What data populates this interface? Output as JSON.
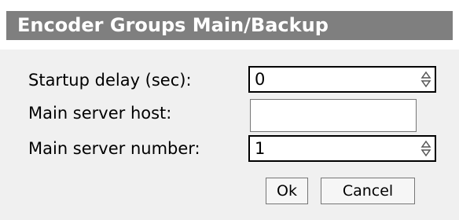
{
  "dialog": {
    "title": "Encoder Groups Main/Backup"
  },
  "form": {
    "startup_delay": {
      "label": "Startup delay (sec):",
      "value": "0"
    },
    "main_server_host": {
      "label": "Main server host:",
      "value": ""
    },
    "main_server_number": {
      "label": "Main server number:",
      "value": "1"
    }
  },
  "buttons": {
    "ok_label": "Ok",
    "cancel_label": "Cancel"
  },
  "icons": {
    "spin_arrows": "up-down-spinner-icon"
  },
  "colors": {
    "title_bar": "#7f7f7f",
    "panel": "#f0f0f0"
  }
}
